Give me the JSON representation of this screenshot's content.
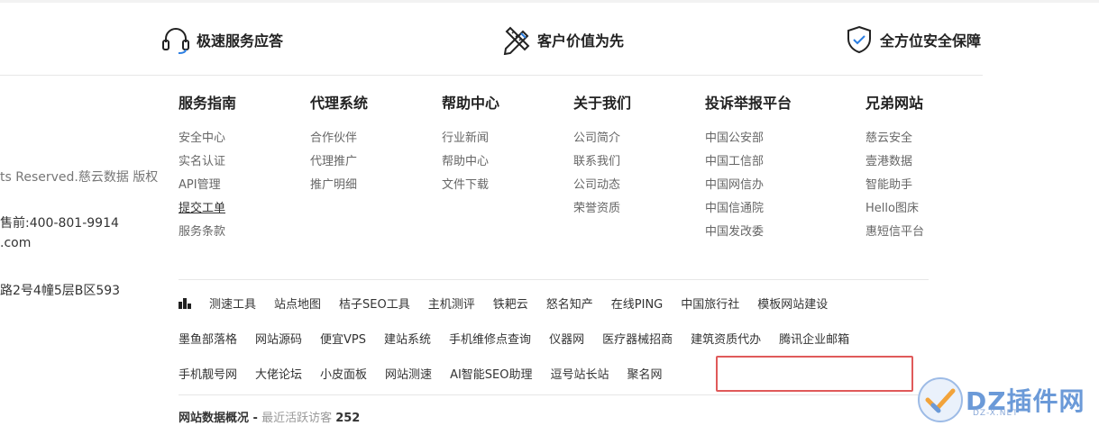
{
  "features": [
    {
      "icon": "headset-icon",
      "label": "极速服务应答"
    },
    {
      "icon": "pencil-ruler-icon",
      "label": "客户价值为先"
    },
    {
      "icon": "shield-check-icon",
      "label": "全方位安全保障"
    }
  ],
  "left_info": {
    "copyright": "ts Reserved.慈云数据 版权",
    "phone": "售前:400-801-9914",
    "email": ".com",
    "address": "路2号4幢5层B区593"
  },
  "columns": [
    {
      "title": "服务指南",
      "items": [
        "安全中心",
        "实名认证",
        "API管理",
        "提交工单",
        "服务条款"
      ]
    },
    {
      "title": "代理系统",
      "items": [
        "合作伙伴",
        "代理推广",
        "推广明细"
      ]
    },
    {
      "title": "帮助中心",
      "items": [
        "行业新闻",
        "帮助中心",
        "文件下载"
      ]
    },
    {
      "title": "关于我们",
      "items": [
        "公司简介",
        "联系我们",
        "公司动态",
        "荣誉资质"
      ]
    },
    {
      "title": "投诉举报平台",
      "items": [
        "中国公安部",
        "中国工信部",
        "中国网信办",
        "中国信通院",
        "中国发改委"
      ]
    },
    {
      "title": "兄弟网站",
      "items": [
        "慈云安全",
        "壹港数据",
        "智能助手",
        "Hello图床",
        "惠短信平台"
      ]
    }
  ],
  "friend_links": {
    "row1": [
      "测速工具",
      "站点地图",
      "桔子SEO工具",
      "主机测评",
      "铁耙云",
      "怒名知产",
      "在线PING",
      "中国旅行社",
      "模板网站建设"
    ],
    "row2": [
      "墨鱼部落格",
      "网站源码",
      "便宜VPS",
      "建站系统",
      "手机维修点查询",
      "仪器网",
      "医疗器械招商",
      "建筑资质代办",
      "腾讯企业邮箱"
    ],
    "row3": [
      "手机靓号网",
      "大佬论坛",
      "小皮面板",
      "网站测速",
      "AI智能SEO助理",
      "逗号站长站",
      "聚名网"
    ]
  },
  "stats": {
    "label": "网站数据概况 -",
    "visitors_label": "最近活跃访客",
    "visitors_count": "252"
  },
  "watermark": {
    "text": "DZ插件网",
    "sub": "DZ-X.NET"
  }
}
